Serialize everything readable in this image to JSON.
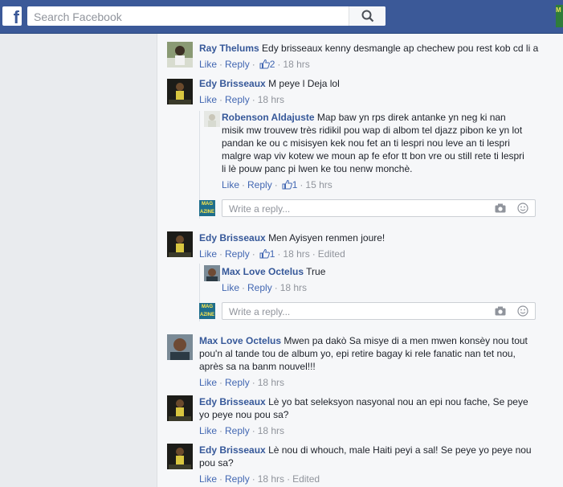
{
  "header": {
    "logo": "f",
    "search_placeholder": "Search Facebook"
  },
  "corner_badge": "M",
  "comments": [
    {
      "author": "Ray Thelums",
      "text": "Edy brisseaux kenny desmangle ap chechew pou rest kob cd li a",
      "like": "Like",
      "reply": "Reply",
      "likes": "2",
      "time": "18 hrs"
    },
    {
      "author": "Edy Brisseaux",
      "text": "M peye l Deja lol",
      "like": "Like",
      "reply": "Reply",
      "time": "18 hrs",
      "replies": [
        {
          "author": "Robenson Aldajuste",
          "text": "Map baw yn rps direk antanke yn neg ki nan misik mw trouvew très ridikil pou wap di albom tel djazz pibon ke yn lot pandan ke ou c misisyen kek nou fet an ti lespri nou leve an ti lespri malgre wap viv kotew we moun ap fe efor tt bon vre ou still rete ti lespri li lè pouw panc pi lwen ke tou nenw monchè.",
          "like": "Like",
          "reply": "Reply",
          "likes": "1",
          "time": "15 hrs"
        }
      ],
      "reply_placeholder": "Write a reply..."
    },
    {
      "author": "Edy Brisseaux",
      "text": "Men Ayisyen renmen joure!",
      "like": "Like",
      "reply": "Reply",
      "likes": "1",
      "time": "18 hrs",
      "edited": "Edited",
      "replies": [
        {
          "author": "Max Love Octelus",
          "text": "True",
          "like": "Like",
          "reply": "Reply",
          "time": "18 hrs"
        }
      ],
      "reply_placeholder": "Write a reply..."
    },
    {
      "author": "Max Love Octelus",
      "text": "Mwen pa dakò Sa misye di a men mwen konsèy nou tout pou'n al tande tou de album yo, epi retire bagay ki rele fanatic nan tet nou, après sa na banm nouvel!!!",
      "like": "Like",
      "reply": "Reply",
      "time": "18 hrs"
    },
    {
      "author": "Edy Brisseaux",
      "text": "Lè yo bat seleksyon nasyonal nou an epi nou fache, Se peye yo peye nou pou sa?",
      "like": "Like",
      "reply": "Reply",
      "time": "18 hrs"
    },
    {
      "author": "Edy Brisseaux",
      "text": "Lè nou di whouch, male Haiti peyi a sal! Se peye yo peye nou pou sa?",
      "like": "Like",
      "reply": "Reply",
      "time": "18 hrs",
      "edited": "Edited"
    }
  ]
}
